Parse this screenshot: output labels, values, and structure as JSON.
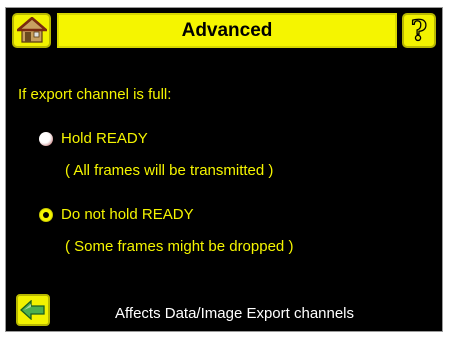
{
  "header": {
    "title": "Advanced",
    "home_icon": "home-icon",
    "help_icon": "help-icon",
    "help_glyph": "?"
  },
  "prompt": "If export channel is full:",
  "options": [
    {
      "label": "Hold READY",
      "description": "( All frames will be transmitted )",
      "selected": false
    },
    {
      "label": "Do not hold READY",
      "description": "( Some frames might be dropped )",
      "selected": true
    }
  ],
  "footer": {
    "back_icon": "back-arrow-icon",
    "note": "Affects Data/Image Export channels"
  },
  "colors": {
    "background": "#000000",
    "accent_yellow": "#f5f500",
    "footer_text": "#ffffff"
  }
}
